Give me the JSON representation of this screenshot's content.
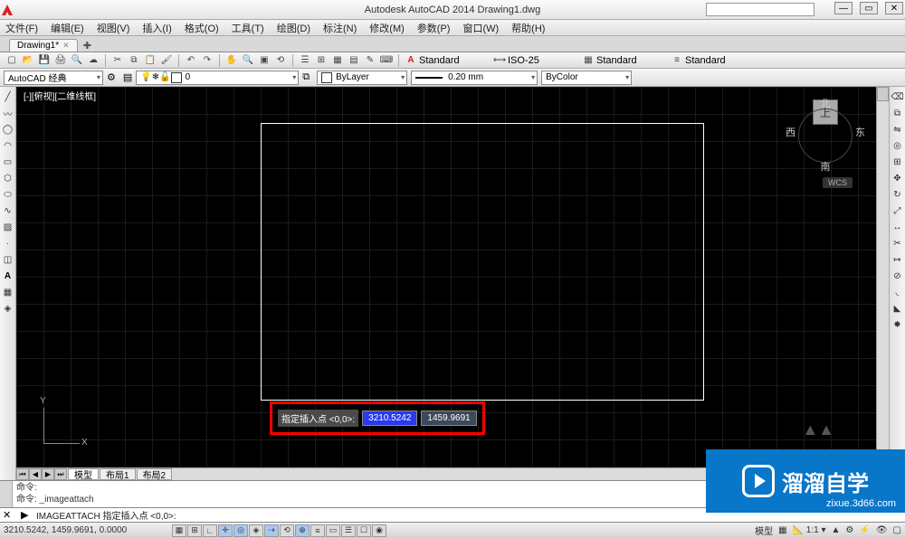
{
  "app": {
    "title": "Autodesk AutoCAD 2014    Drawing1.dwg"
  },
  "menu": [
    "文件(F)",
    "编辑(E)",
    "视图(V)",
    "插入(I)",
    "格式(O)",
    "工具(T)",
    "绘图(D)",
    "标注(N)",
    "修改(M)",
    "参数(P)",
    "窗口(W)",
    "帮助(H)"
  ],
  "doc_tab": {
    "name": "Drawing1*"
  },
  "workspace": "AutoCAD 经典",
  "props": {
    "layer": "0",
    "style": "Standard",
    "dimstyle": "ISO-25",
    "tablestyle": "Standard",
    "mlstyle": "Standard",
    "color": "ByLayer",
    "lineweight": "0.20 mm",
    "linetype": "ByColor"
  },
  "viewport_label": "[-][俯视][二维线框]",
  "viewcube": {
    "n": "北",
    "s": "南",
    "e": "东",
    "w": "西",
    "top": "上",
    "wcs": "WCS"
  },
  "ucs": {
    "x": "X",
    "y": "Y"
  },
  "dyn": {
    "prompt": "指定插入点 <0,0>:",
    "x": "3210.5242",
    "y": "1459.9691"
  },
  "model_tabs": [
    "模型",
    "布局1",
    "布局2"
  ],
  "cmd": {
    "line1": "命令:",
    "line2": "命令: _imageattach",
    "prompt": "IMAGEATTACH 指定插入点 <0,0>:",
    "arrow": "▶"
  },
  "status": {
    "coords": "3210.5242, 1459.9691, 0.0000",
    "right1": "模型",
    "scale": "1:1",
    "ann": "▲"
  },
  "watermark": {
    "brand": "溜溜自学",
    "url": "zixue.3d66.com"
  }
}
